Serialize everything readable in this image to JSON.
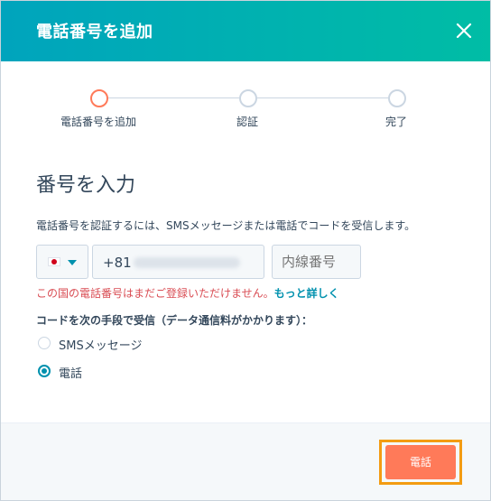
{
  "header": {
    "title": "電話番号を追加",
    "close_icon": "close-icon"
  },
  "stepper": {
    "steps": [
      {
        "label": "電話番号を追加",
        "state": "active"
      },
      {
        "label": "認証",
        "state": "pending"
      },
      {
        "label": "完了",
        "state": "pending"
      }
    ]
  },
  "form": {
    "section_title": "番号を入力",
    "description": "電話番号を認証するには、SMSメッセージまたは電話でコードを受信します。",
    "country": {
      "flag": "japan-flag-icon",
      "caret": "caret-down-icon"
    },
    "phone": {
      "prefix": "+81"
    },
    "extension": {
      "placeholder": "内線番号"
    },
    "error": {
      "text": "この国の電話番号はまだご登録いただけません。",
      "link": "もっと詳しく"
    },
    "method_label": "コードを次の手段で受信（データ通信料がかかります）：",
    "methods": [
      {
        "label": "SMSメッセージ",
        "checked": false
      },
      {
        "label": "電話",
        "checked": true
      }
    ]
  },
  "footer": {
    "primary_button": "電話"
  },
  "colors": {
    "header_start": "#00a4bd",
    "header_end": "#00bda5",
    "primary": "#ff7a59",
    "link": "#0091ae",
    "error": "#d94c53",
    "highlight": "#f39c12"
  }
}
